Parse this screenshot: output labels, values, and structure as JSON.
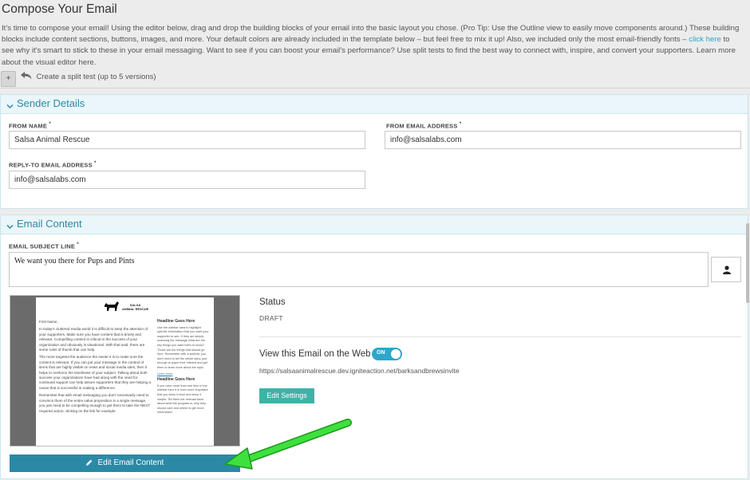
{
  "page": {
    "title": "Compose Your Email",
    "intro_part1": "It’s time to compose your email! Using the editor below, drag and drop the building blocks of your email into the basic layout you chose. (Pro Tip: Use the Outline view to easily move components around.) These building blocks include content sections, buttons, images, and more. Your default colors are already included in the template below – but feel free to mix it up! Also, we included only the most email-friendly fonts –",
    "intro_link": "click here",
    "intro_part2": "to see why it's smart to stick to these in your email messaging. Want to see if you can boost your email's performance? Use split tests to find the best way to connect with, inspire, and convert your supporters. Learn more about the visual editor here."
  },
  "split_test": {
    "add_label": "+",
    "link_label": "Create a split test (up to 5 versions)"
  },
  "sender": {
    "section_title": "Sender Details",
    "from_name_label": "FROM NAME",
    "from_name_value": "Salsa Animal Rescue",
    "from_email_label": "FROM EMAIL ADDRESS",
    "from_email_value": "info@salsalabs.com",
    "reply_to_label": "REPLY-TO EMAIL ADDRESS",
    "reply_to_value": "info@salsalabs.com",
    "required_mark": "*"
  },
  "content": {
    "section_title": "Email Content",
    "subject_label": "EMAIL SUBJECT LINE",
    "subject_value": "We want you there for Pups and Pints",
    "edit_button": "Edit Email Content",
    "status_label": "Status",
    "status_value": "DRAFT",
    "web_label": "View this Email on the Web",
    "web_toggle": "ON",
    "web_url": "https://salsaanimalrescue.dev.igniteaction.net/barksandbrewsinvite",
    "settings_button": "Edit Settings"
  },
  "preview": {
    "logo_line1": "SALSA",
    "logo_line2": "ANIMAL RESCUE",
    "greeting": "First Name,",
    "para1": "In today's cluttered media world it is difficult to keep the attention of your supporters. Make sure you have content that is timely and relevant. Compelling content is critical to the success of your organization and obviously is situational. With that said, there are some rules of thumb that can help.",
    "para2": "The more targeted the audience the easier it is to make sure the content is relevant. If you can put your message in the context of items that are highly visible on news and social media sites, then it helps to reinforce the timeliness of your subject. Talking about both success your organizations have had along with the need for continued support can help assure supporters that they are helping a cause that is successful in making a difference.",
    "para3": "Remember that with email messaging you don't necessarily need to convince them of the entire value proposition in a single message, you just need to be compelling enough to get them to take the NEXT required action; clicking on the link for example.",
    "side_heading1": "Headline Goes Here",
    "side_text1": "Use the sidebar area to highlight specific information that you want your supporter to see. If they are simply scanning the message what are the key things you want them to know? Those are the things that should go here. Remember with a sidebar, you don't need to tell the whole story, just enough to pique their interest and get them to learn more about the topic.",
    "side_link": "Learn more",
    "side_heading2": "Headline Goes Here",
    "side_text2": "If you have more than one item in the sidebar then it is even more important that you keep it short and keep it simple. Tell them the relevant facts about what the program is, why they should care and where to get more information."
  },
  "colors": {
    "accent": "#2a8aa6",
    "settings_button": "#3fb2a6",
    "toggle_on": "#2aa8cc",
    "panel_header": "#eaf6f9",
    "annotation_arrow": "#22cc22"
  }
}
